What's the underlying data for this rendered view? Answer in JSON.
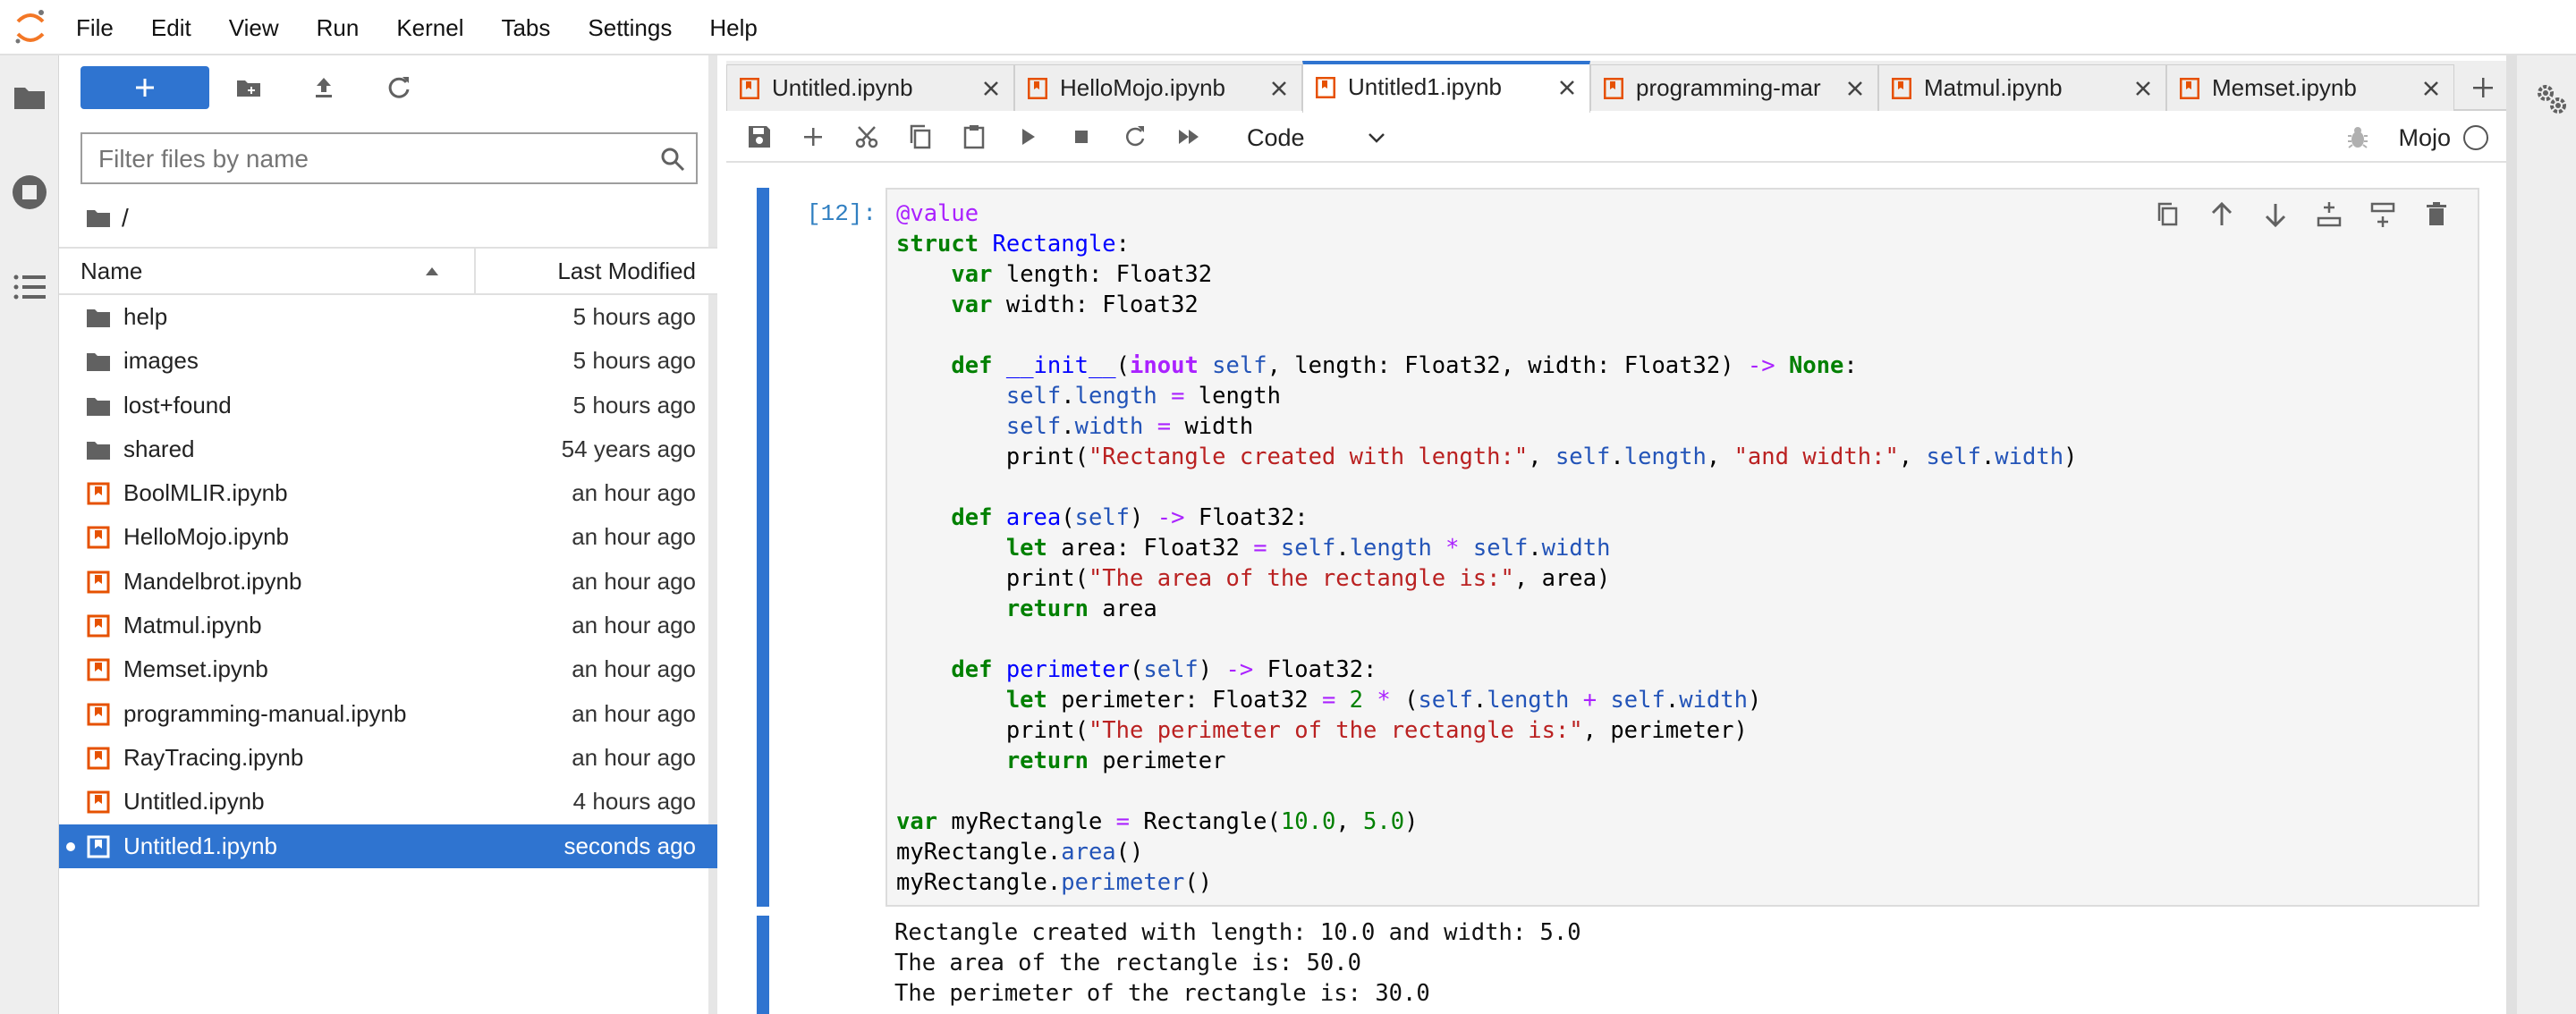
{
  "menubar": {
    "items": [
      "File",
      "Edit",
      "View",
      "Run",
      "Kernel",
      "Tabs",
      "Settings",
      "Help"
    ]
  },
  "filebrowser": {
    "filter_placeholder": "Filter files by name",
    "breadcrumb": "/",
    "header_name": "Name",
    "header_modified": "Last Modified",
    "files": [
      {
        "name": "help",
        "modified": "5 hours ago",
        "type": "folder"
      },
      {
        "name": "images",
        "modified": "5 hours ago",
        "type": "folder"
      },
      {
        "name": "lost+found",
        "modified": "5 hours ago",
        "type": "folder"
      },
      {
        "name": "shared",
        "modified": "54 years ago",
        "type": "folder"
      },
      {
        "name": "BoolMLIR.ipynb",
        "modified": "an hour ago",
        "type": "notebook"
      },
      {
        "name": "HelloMojo.ipynb",
        "modified": "an hour ago",
        "type": "notebook"
      },
      {
        "name": "Mandelbrot.ipynb",
        "modified": "an hour ago",
        "type": "notebook"
      },
      {
        "name": "Matmul.ipynb",
        "modified": "an hour ago",
        "type": "notebook"
      },
      {
        "name": "Memset.ipynb",
        "modified": "an hour ago",
        "type": "notebook"
      },
      {
        "name": "programming-manual.ipynb",
        "modified": "an hour ago",
        "type": "notebook"
      },
      {
        "name": "RayTracing.ipynb",
        "modified": "an hour ago",
        "type": "notebook"
      },
      {
        "name": "Untitled.ipynb",
        "modified": "4 hours ago",
        "type": "notebook"
      },
      {
        "name": "Untitled1.ipynb",
        "modified": "seconds ago",
        "type": "notebook",
        "selected": true
      }
    ]
  },
  "tabs": [
    {
      "label": "Untitled.ipynb",
      "active": false
    },
    {
      "label": "HelloMojo.ipynb",
      "active": false
    },
    {
      "label": "Untitled1.ipynb",
      "active": true
    },
    {
      "label": "programming-mar",
      "active": false
    },
    {
      "label": "Matmul.ipynb",
      "active": false
    },
    {
      "label": "Memset.ipynb",
      "active": false
    }
  ],
  "notebook_toolbar": {
    "cell_type": "Code",
    "kernel_name": "Mojo"
  },
  "cell": {
    "prompt": "[12]:",
    "code_lines": [
      "@value",
      "struct Rectangle:",
      "    var length: Float32",
      "    var width: Float32",
      "",
      "    def __init__(inout self, length: Float32, width: Float32) -> None:",
      "        self.length = length",
      "        self.width = width",
      "        print(\"Rectangle created with length:\", self.length, \"and width:\", self.width)",
      "",
      "    def area(self) -> Float32:",
      "        let area: Float32 = self.length * self.width",
      "        print(\"The area of the rectangle is:\", area)",
      "        return area",
      "",
      "    def perimeter(self) -> Float32:",
      "        let perimeter: Float32 = 2 * (self.length + self.width)",
      "        print(\"The perimeter of the rectangle is:\", perimeter)",
      "        return perimeter",
      "",
      "var myRectangle = Rectangle(10.0, 5.0)",
      "myRectangle.area()",
      "myRectangle.perimeter()"
    ],
    "output_lines": [
      "Rectangle created with length: 10.0 and width: 5.0",
      "The area of the rectangle is: 50.0",
      "The perimeter of the rectangle is: 30.0"
    ]
  },
  "colors": {
    "accent": "#2f74d0",
    "notebook_icon": "#e65100",
    "jupyter_orange": "#f37726"
  },
  "icons": {
    "logo": "jupyter-logo",
    "left_strip": [
      "folder-icon",
      "running-icon",
      "toc-icon"
    ],
    "fb_toolbar": [
      "new-folder-icon",
      "upload-icon",
      "refresh-icon"
    ],
    "nb_toolbar": [
      "save-icon",
      "add-cell-icon",
      "cut-icon",
      "copy-icon",
      "paste-icon",
      "run-icon",
      "stop-icon",
      "restart-icon",
      "run-all-icon"
    ],
    "cell_tools": [
      "duplicate-icon",
      "move-up-icon",
      "move-down-icon",
      "insert-above-icon",
      "insert-below-icon",
      "delete-icon"
    ],
    "right_strip": "property-inspector-icon"
  }
}
